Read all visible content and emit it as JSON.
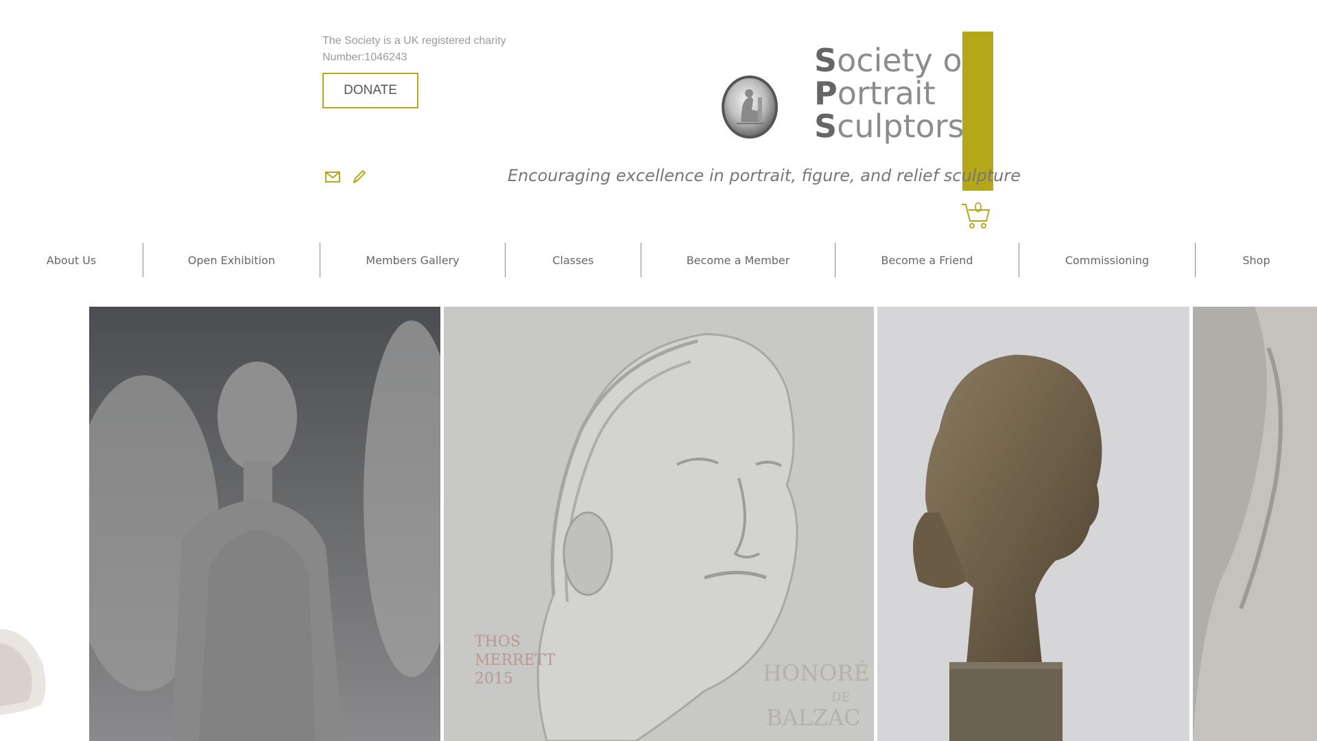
{
  "header": {
    "charity_line1": "The Society is a UK registered charity",
    "charity_line2": "Number:1046243",
    "donate_label": "DONATE",
    "tagline": "Encouraging excellence in portrait, figure, and relief sculpture",
    "cart_count": "0",
    "social_icons": [
      "mail-icon",
      "pencil-icon"
    ]
  },
  "logo": {
    "line1_initial": "S",
    "line1_rest": "ociety of",
    "line2_initial": "P",
    "line2_rest": "ortrait",
    "line3_initial": "S",
    "line3_rest": "culptors"
  },
  "nav": {
    "items": [
      {
        "label": "About Us"
      },
      {
        "label": "Open Exhibition"
      },
      {
        "label": "Members Gallery"
      },
      {
        "label": "Classes"
      },
      {
        "label": "Become a Member"
      },
      {
        "label": "Become a Friend"
      },
      {
        "label": "Commissioning"
      },
      {
        "label": "Shop"
      }
    ]
  },
  "gallery": {
    "relief_inscription_artist": "THOS MERRETT 2015",
    "relief_inscription_subject": "HONORÉ DE BALZAC"
  },
  "colors": {
    "accent": "#b5a71a",
    "text_grey": "#9a9a9a",
    "nav_text": "#666666"
  }
}
